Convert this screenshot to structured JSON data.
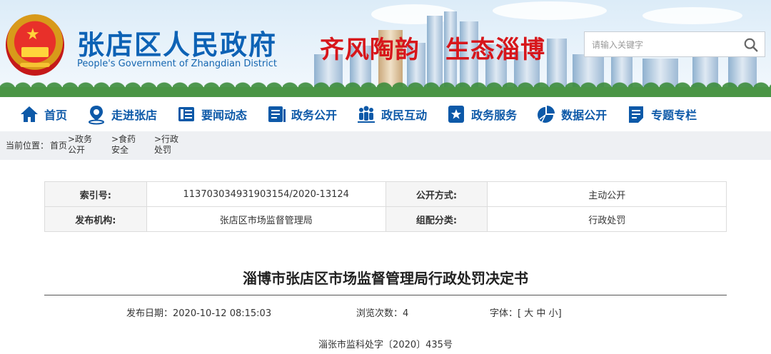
{
  "header": {
    "site_title": "张店区人民政府",
    "site_subtitle": "People's Government of Zhangdian District",
    "slogan_left": "齐风陶韵",
    "slogan_right": "生态淄博",
    "search_placeholder": "请输入关键字",
    "brand_color": "#0d62b5"
  },
  "nav": {
    "items": [
      {
        "label": "首页",
        "icon": "home-icon"
      },
      {
        "label": "走进张店",
        "icon": "location-pin-icon"
      },
      {
        "label": "要闻动态",
        "icon": "news-icon"
      },
      {
        "label": "政务公开",
        "icon": "document-icon"
      },
      {
        "label": "政民互动",
        "icon": "people-icon"
      },
      {
        "label": "政务服务",
        "icon": "star-service-icon"
      },
      {
        "label": "数据公开",
        "icon": "pie-chart-icon"
      },
      {
        "label": "专题专栏",
        "icon": "topic-icon"
      }
    ]
  },
  "breadcrumb": {
    "prefix": "当前位置：",
    "home": "首页",
    "items": [
      ">政务公开",
      ">食药安全",
      ">行政处罚"
    ]
  },
  "meta": {
    "index_no_label": "索引号:",
    "index_no_value": "113703034931903154/2020-13124",
    "public_mode_label": "公开方式:",
    "public_mode_value": "主动公开",
    "publisher_label": "发布机构:",
    "publisher_value": "张店区市场监督管理局",
    "category_label": "组配分类:",
    "category_value": "行政处罚"
  },
  "article": {
    "title": "淄博市张店区市场监督管理局行政处罚决定书",
    "publish_date_label": "发布日期：",
    "publish_date": "2020-10-12 08:15:03",
    "views_label": "浏览次数：",
    "views": "4",
    "font_label": "字体：",
    "font_open": "[",
    "font_large": "大",
    "font_medium": "中",
    "font_small": "小",
    "font_close": "]",
    "doc_number": "淄张市监科处字〔2020〕435号"
  }
}
